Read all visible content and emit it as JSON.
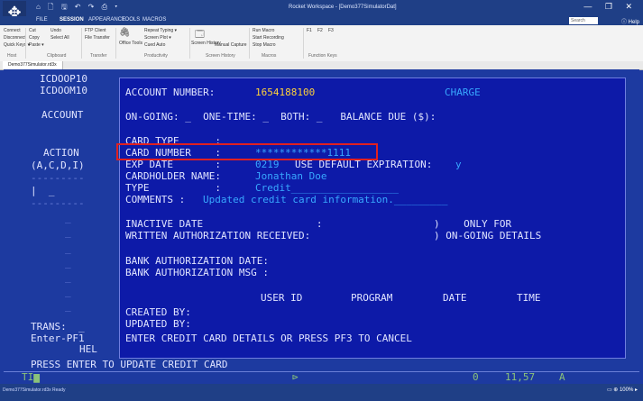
{
  "app": {
    "title": "Rocket Workspace - [Demo377SimulatorDat]",
    "quick_access": "⌂ 🗋 🖫 ↶ ↷ ⎙ ▾",
    "window_controls": "— ❐ ✕",
    "tabs": [
      "FILE",
      "SESSION",
      "APPEARANCE",
      "TOOLS",
      "MACROS"
    ],
    "search_placeholder": "Search",
    "help": "ⓘ Help",
    "document_tab": "Demo377Simulator.rd3x"
  },
  "ribbon": {
    "groups": [
      {
        "label": "Host",
        "items": [
          "Connect",
          "Disconnect",
          "Quick Keys ▾"
        ]
      },
      {
        "label": "Clipboard",
        "items": [
          "Cut",
          "Copy",
          "Paste ▾",
          "Undo",
          "Select All"
        ]
      },
      {
        "label": "Transfer",
        "items": [
          "FTP Client",
          "File Transfer"
        ]
      },
      {
        "label": "Productivity",
        "items": [
          "Office Tools",
          "Repeat Typing ▾",
          "Screen Plot ▾",
          "Cued Auto"
        ]
      },
      {
        "label": "Screen History",
        "items": [
          "Screen History",
          "Manual Capture"
        ]
      },
      {
        "label": "Macros",
        "items": [
          "Run Macro",
          "Start Recording",
          "Stop Macro"
        ]
      },
      {
        "label": "Function Keys",
        "items": [
          "F1",
          "F2",
          "F3"
        ]
      }
    ]
  },
  "screen": {
    "left": {
      "l1": "ICDOOP10",
      "l2": "ICDOOM10",
      "account": "ACCOUNT",
      "action": "ACTION",
      "action_codes": "(A,C,D,I)",
      "dashes1": "---------",
      "action_field": "|  _",
      "dashes2": "---------",
      "underscores": [
        "_",
        "_",
        "_",
        "_",
        "_",
        "_",
        "_"
      ],
      "trans": "TRANS:  _",
      "enter_pf1": "Enter-PF1",
      "hel": "HEL"
    },
    "panel": {
      "account_label": "ACCOUNT NUMBER:",
      "account_value": "1654188100",
      "charge": "CHARGE",
      "ongoing_line": "ON-GOING: _  ONE-TIME: _  BOTH: _   BALANCE DUE ($):",
      "card_type_label": "CARD TYPE      :",
      "card_number_label": "CARD NUMBER    :",
      "card_number_value": "************1111",
      "exp_date_label": "EXP DATE       :",
      "exp_date_value": "0219",
      "use_default": "USE DEFAULT EXPIRATION:",
      "use_default_value": "y",
      "cardholder_label": "CARDHOLDER NAME:",
      "cardholder_value": "Jonathan Doe",
      "type_label": "TYPE           :",
      "type_value": "Credit__________________",
      "comments_label": "COMMENTS :",
      "comments_value": "Updated credit card information._________",
      "inactive_date": "INACTIVE DATE                   :",
      "only_for": ")    ONLY FOR",
      "written_auth": "WRITTEN AUTHORIZATION RECEIVED:",
      "ongoing_details": ") ON-GOING DETAILS",
      "bank_auth_date": "BANK AUTHORIZATION DATE:",
      "bank_auth_msg": "BANK AUTHORIZATION MSG :",
      "col_user_id": "USER ID",
      "col_program": "PROGRAM",
      "col_date": "DATE",
      "col_time": "TIME",
      "created_by": "CREATED BY:",
      "updated_by": "UPDATED BY:",
      "instructions": "ENTER CREDIT CARD DETAILS OR PRESS PF3 TO CANCEL"
    },
    "press_enter": "PRESS ENTER TO UPDATE CREDIT CARD",
    "status": {
      "indicator": "TI▆",
      "center": "⊳",
      "left_code": "0",
      "cursor_pos": "11,57",
      "mode": "A"
    }
  },
  "statusbar": {
    "left": "Demo377Simulator.rd3x Ready",
    "right": "▭ ⊕ 100% ▸"
  },
  "colors": {
    "screen_bg": "#1d3aa0",
    "panel_bg": "#0d1aa8",
    "field_blue": "#38a8ff",
    "highlight_yellow": "#ffd23a",
    "selection_red": "#e02020"
  }
}
